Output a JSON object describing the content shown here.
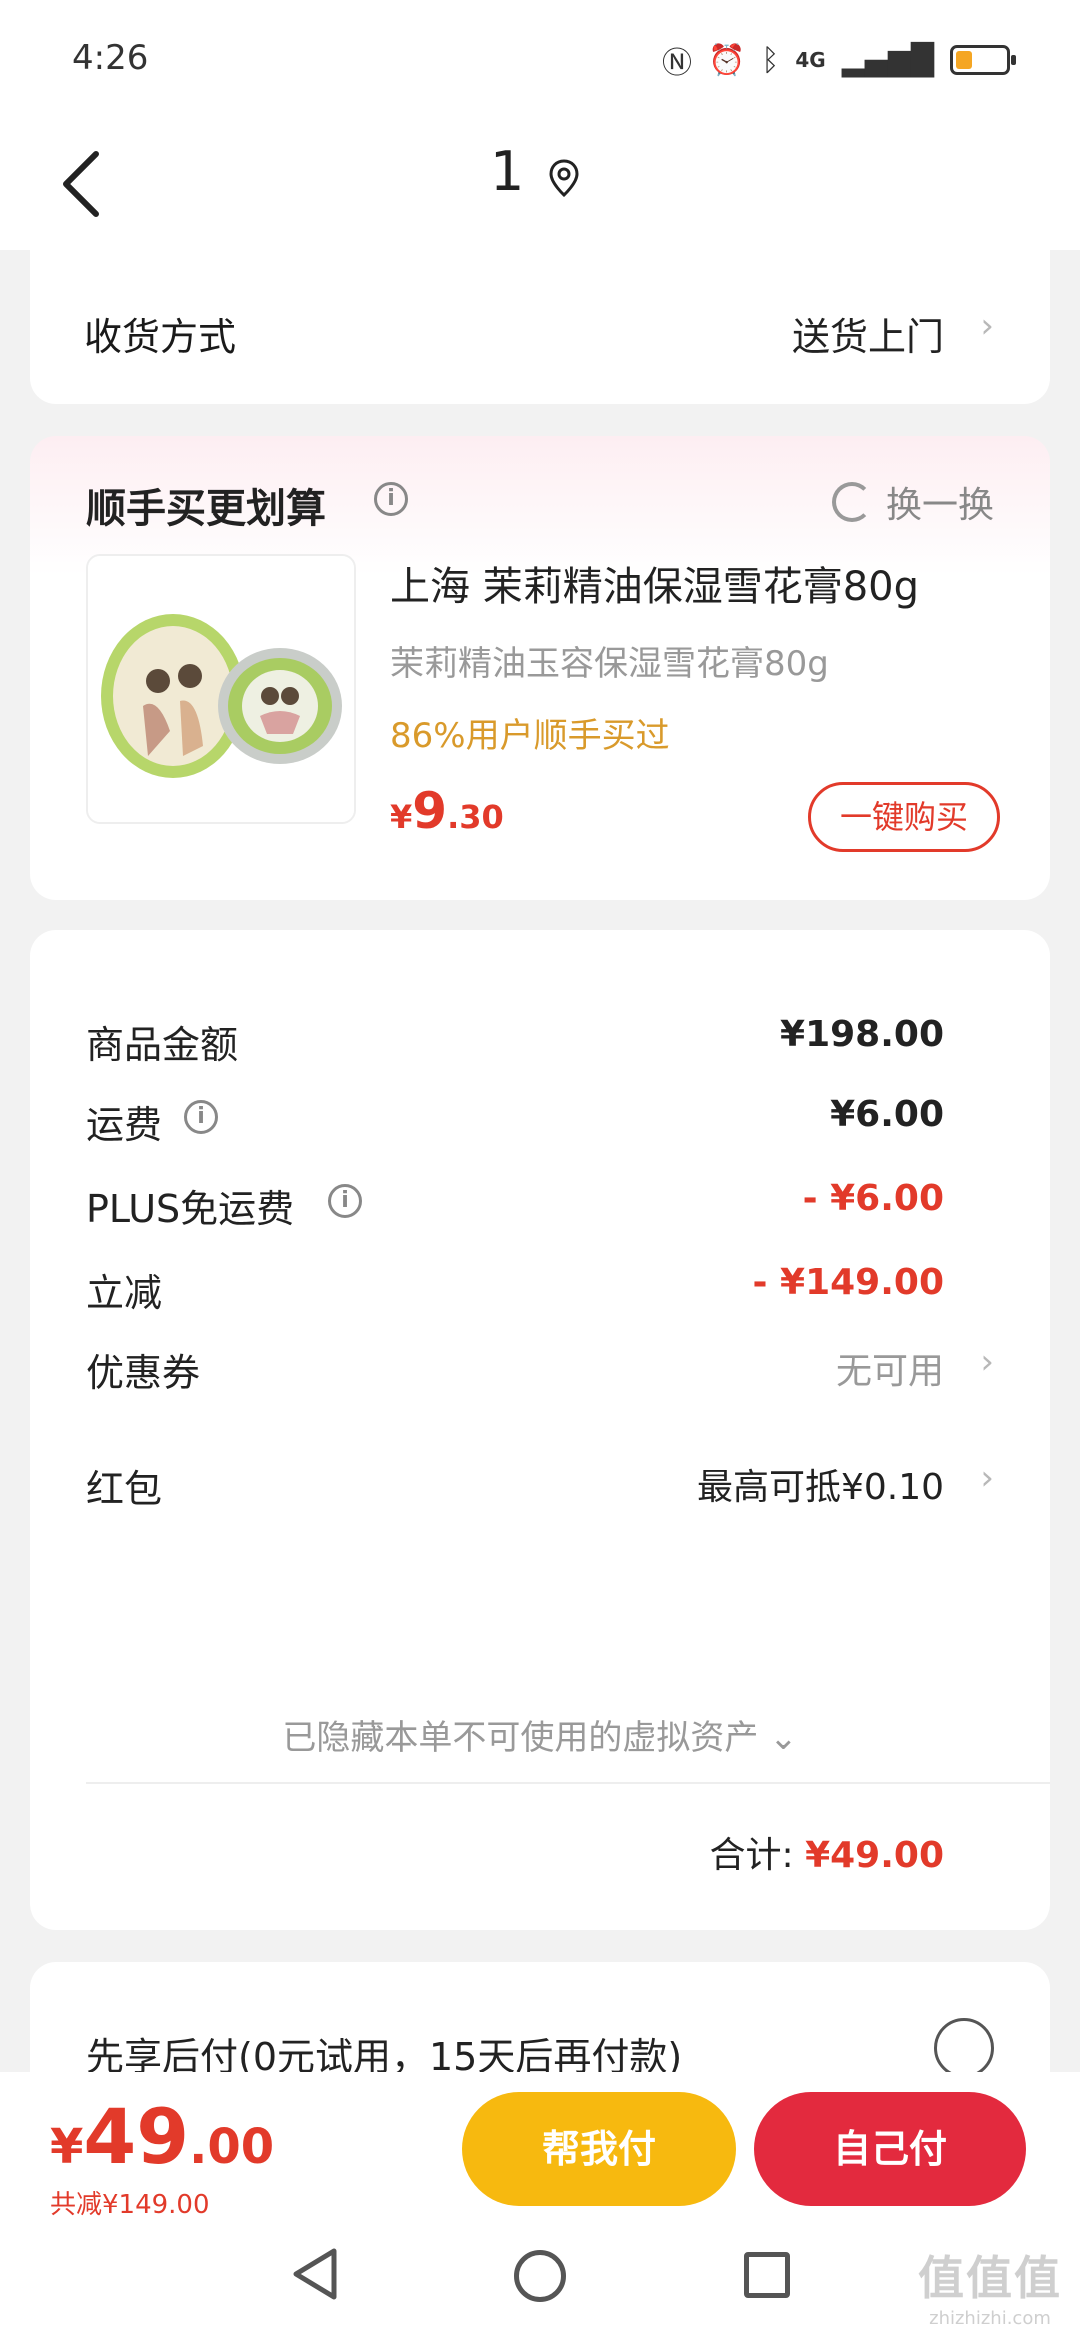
{
  "status_bar": {
    "time": "4:26",
    "network": "4G",
    "battery_level": 0.3
  },
  "header": {
    "title": "1",
    "back_icon": "chevron-left-icon",
    "location_icon": "location-pin-icon"
  },
  "delivery": {
    "label": "收货方式",
    "value": "送货上门"
  },
  "addon": {
    "title": "顺手买更划算",
    "swap_label": "换一换",
    "product": {
      "name": "上海 茉莉精油保湿雪花膏80g",
      "subtitle": "茉莉精油玉容保湿雪花膏80g",
      "percent_text": "86%用户顺手买过",
      "price_symbol": "¥",
      "price_int": "9",
      "price_dec": ".30",
      "buy_label": "一键购买"
    }
  },
  "summary": {
    "goods_amount": {
      "label": "商品金额",
      "value": "¥198.00"
    },
    "shipping": {
      "label": "运费",
      "value": "¥6.00"
    },
    "plus_free_shipping": {
      "label": "PLUS免运费",
      "value": "- ¥6.00"
    },
    "instant_discount": {
      "label": "立减",
      "value": "- ¥149.00"
    },
    "coupon": {
      "label": "优惠券",
      "value": "无可用"
    },
    "red_packet": {
      "label": "红包",
      "value": "最高可抵¥0.10"
    },
    "hidden_note": "已隐藏本单不可使用的虚拟资产",
    "total_label": "合计:",
    "total_value": "¥49.00"
  },
  "payment": {
    "label": "先享后付(0元试用，15天后再付款)"
  },
  "bottom_bar": {
    "price_symbol": "¥",
    "price_int": "49",
    "price_dec": ".00",
    "saved_text": "共减¥149.00",
    "helper_pay_label": "帮我付",
    "self_pay_label": "自己付"
  },
  "watermark": {
    "logo": "值值值",
    "site": "zhizhizhi.com"
  },
  "colors": {
    "accent_red": "#e23a2a",
    "helper_yellow": "#f7b90f",
    "self_pay_red": "#e32a3e",
    "percent_orange": "#d99a2b"
  }
}
